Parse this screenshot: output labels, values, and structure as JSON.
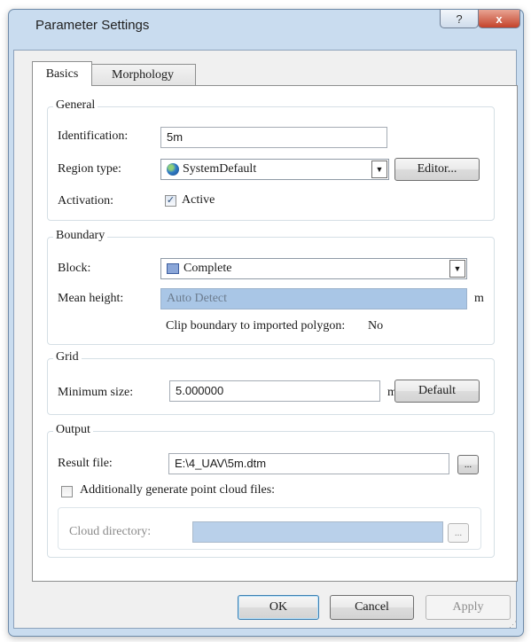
{
  "window": {
    "title": "Parameter Settings",
    "help_glyph": "?",
    "close_glyph": "x"
  },
  "tabs": [
    {
      "label": "Basics",
      "active": true
    },
    {
      "label": "Morphology",
      "active": false
    }
  ],
  "general": {
    "title": "General",
    "identification_label": "Identification:",
    "identification_value": "5m",
    "region_type_label": "Region type:",
    "region_type_value": "SystemDefault",
    "editor_button": "Editor...",
    "activation_label": "Activation:",
    "active_checkbox_label": "Active",
    "active_checked": true
  },
  "boundary": {
    "title": "Boundary",
    "block_label": "Block:",
    "block_value": "Complete",
    "mean_height_label": "Mean height:",
    "mean_height_value": "Auto Detect",
    "mean_height_unit": "m",
    "clip_label": "Clip boundary to imported polygon:",
    "clip_value": "No"
  },
  "grid": {
    "title": "Grid",
    "min_size_label": "Minimum size:",
    "min_size_value": "5.000000",
    "unit": "m",
    "default_button": "Default"
  },
  "output": {
    "title": "Output",
    "result_file_label": "Result file:",
    "result_file_value": "E:\\4_UAV\\5m.dtm",
    "browse_label": "...",
    "point_cloud_label": "Additionally generate point cloud files:",
    "point_cloud_checked": false,
    "cloud_dir_label": "Cloud directory:",
    "cloud_dir_value": "",
    "cloud_browse_label": "..."
  },
  "buttons": {
    "ok": "OK",
    "cancel": "Cancel",
    "apply": "Apply"
  },
  "colors": {
    "frame": "#c9dcef",
    "readonly_field": "#a9c6e6",
    "close_button": "#c4432b"
  }
}
